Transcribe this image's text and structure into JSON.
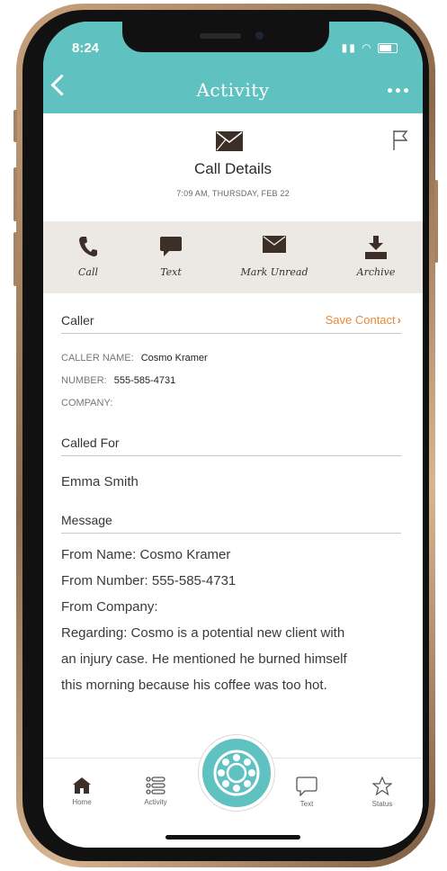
{
  "status_bar": {
    "time": "8:24"
  },
  "nav": {
    "title": "Activity"
  },
  "detail": {
    "title": "Call Details",
    "timestamp": "7:09 AM, THURSDAY, FEB 22"
  },
  "actions": [
    {
      "label": "Call",
      "icon": "phone-icon"
    },
    {
      "label": "Text",
      "icon": "chat-bubble-icon"
    },
    {
      "label": "Mark Unread",
      "icon": "envelope-icon"
    },
    {
      "label": "Archive",
      "icon": "archive-download-icon"
    }
  ],
  "caller": {
    "heading": "Caller",
    "save_contact": "Save Contact",
    "name_label": "CALLER NAME:",
    "name_value": "Cosmo Kramer",
    "number_label": "NUMBER:",
    "number_value": "555-585-4731",
    "company_label": "COMPANY:"
  },
  "called_for": {
    "heading": "Called For",
    "value": "Emma Smith"
  },
  "message": {
    "heading": "Message",
    "lines": [
      "From Name: Cosmo Kramer",
      "From Number: 555-585-4731",
      "From Company:",
      "Regarding: Cosmo is a potential new client with",
      "an injury case. He mentioned he burned himself",
      "this morning because his coffee was too hot."
    ]
  },
  "tabbar": {
    "items": [
      {
        "label": "Home",
        "icon": "home-icon"
      },
      {
        "label": "Activity",
        "icon": "list-icon"
      },
      {
        "label": "Text",
        "icon": "chat-bubble-icon"
      },
      {
        "label": "Status",
        "icon": "star-icon"
      }
    ],
    "center_icon": "rotary-dial-icon"
  },
  "colors": {
    "accent": "#5fc2c0",
    "action_bar": "#ece8e3",
    "link": "#e88a3a",
    "icon_dark": "#3b2f27"
  }
}
